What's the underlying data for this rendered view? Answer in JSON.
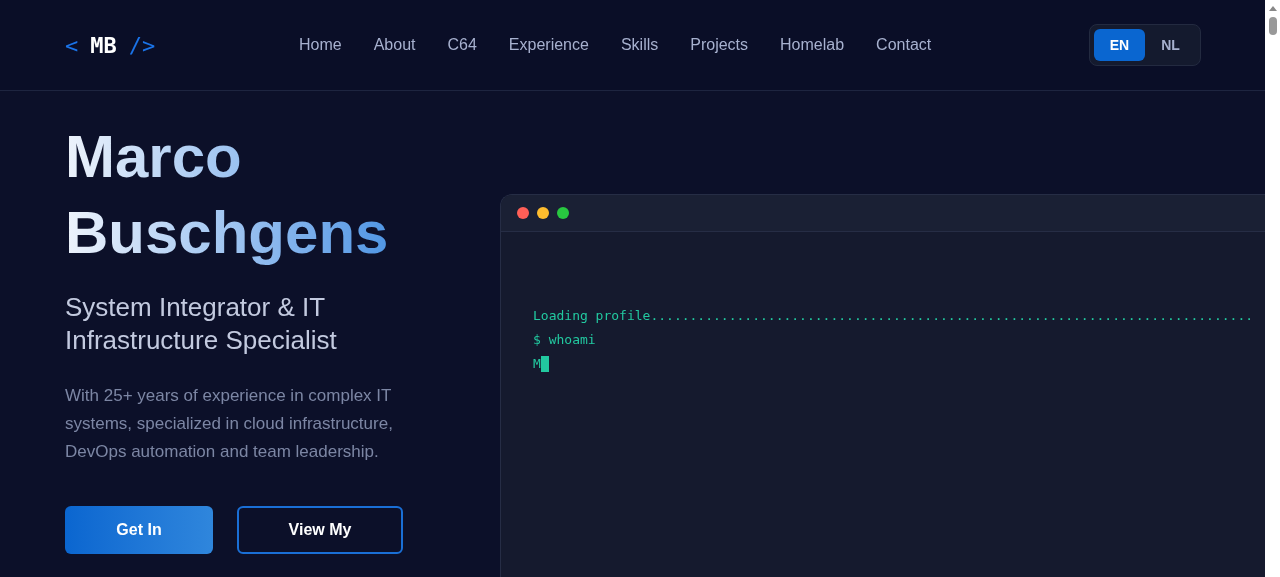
{
  "header": {
    "logo": {
      "open": "<",
      "name": "MB",
      "close": "/>"
    },
    "nav": [
      {
        "label": "Home"
      },
      {
        "label": "About"
      },
      {
        "label": "C64"
      },
      {
        "label": "Experience"
      },
      {
        "label": "Skills"
      },
      {
        "label": "Projects"
      },
      {
        "label": "Homelab"
      },
      {
        "label": "Contact"
      }
    ],
    "languages": [
      {
        "label": "EN",
        "selected": true
      },
      {
        "label": "NL",
        "selected": false
      }
    ]
  },
  "hero": {
    "name_lines": [
      "Marco",
      "Buschgens"
    ],
    "title": "System Integrator & IT Infrastructure Specialist",
    "description": "With 25+ years of experience in complex IT systems, specialized in cloud infrastructure, DevOps automation and team leadership.",
    "buttons": [
      {
        "label": "Get In",
        "kind": "primary"
      },
      {
        "label": "View My",
        "kind": "outline"
      }
    ]
  },
  "terminal": {
    "lines": [
      "Loading profile.............................................................................",
      "$ whoami",
      "M"
    ]
  }
}
